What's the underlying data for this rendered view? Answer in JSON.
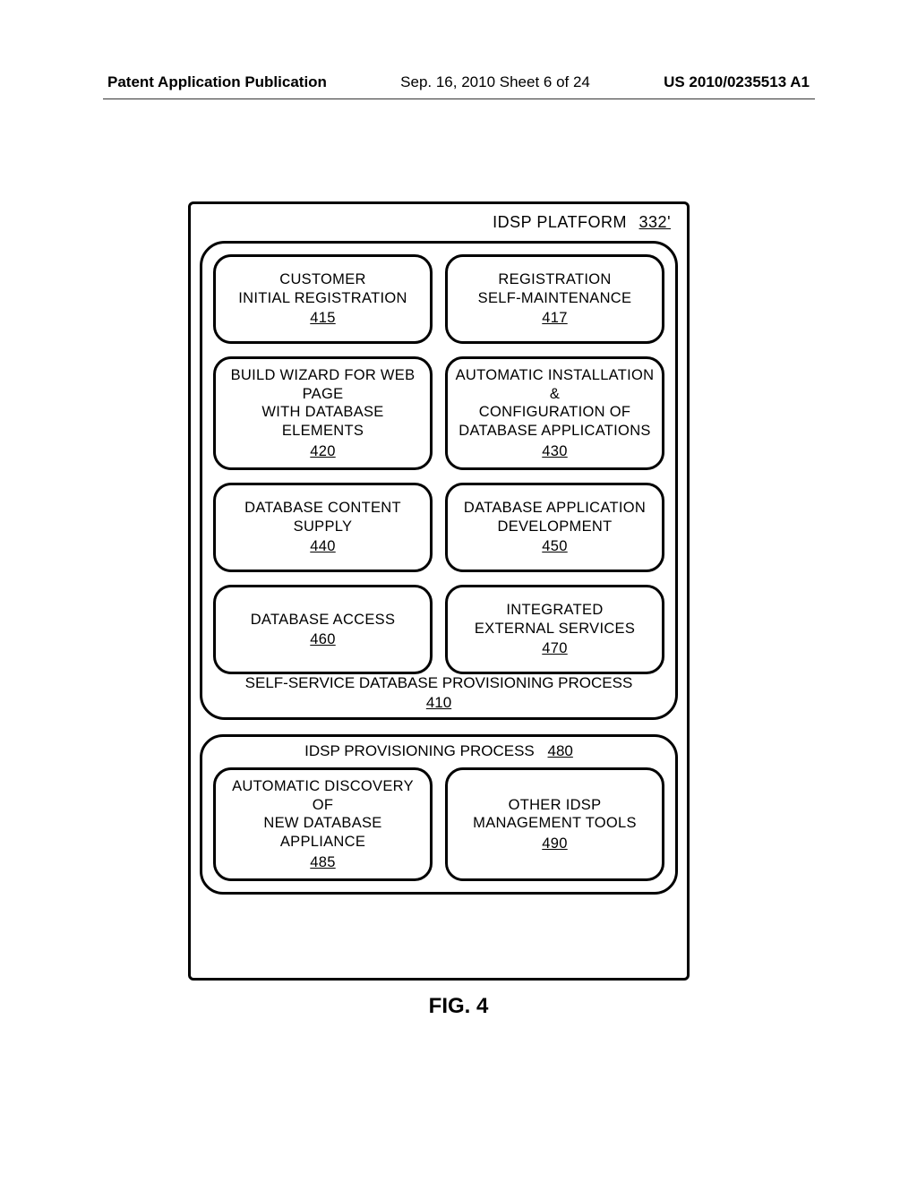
{
  "header": {
    "publication": "Patent Application Publication",
    "date": "Sep. 16, 2010  Sheet 6 of 24",
    "appnum": "US 2010/0235513 A1"
  },
  "platform": {
    "title": "IDSP PLATFORM",
    "ref": "332'"
  },
  "process410": {
    "title": "SELF-SERVICE DATABASE PROVISIONING PROCESS",
    "ref": "410",
    "cells": [
      {
        "text": "CUSTOMER\nINITIAL REGISTRATION",
        "ref": "415"
      },
      {
        "text": "REGISTRATION\nSELF-MAINTENANCE",
        "ref": "417"
      },
      {
        "text": "BUILD WIZARD FOR WEB PAGE\nWITH DATABASE ELEMENTS",
        "ref": "420"
      },
      {
        "text": "AUTOMATIC INSTALLATION &\nCONFIGURATION OF\nDATABASE APPLICATIONS",
        "ref": "430"
      },
      {
        "text": "DATABASE CONTENT\nSUPPLY",
        "ref": "440"
      },
      {
        "text": "DATABASE APPLICATION\nDEVELOPMENT",
        "ref": "450"
      },
      {
        "text": "DATABASE ACCESS",
        "ref": "460"
      },
      {
        "text": "INTEGRATED\nEXTERNAL SERVICES",
        "ref": "470"
      }
    ]
  },
  "process480": {
    "title": "IDSP PROVISIONING PROCESS",
    "ref": "480",
    "cells": [
      {
        "text": "AUTOMATIC DISCOVERY OF\nNEW DATABASE APPLIANCE",
        "ref": "485"
      },
      {
        "text": "OTHER IDSP\nMANAGEMENT TOOLS",
        "ref": "490"
      }
    ]
  },
  "figure": "FIG. 4"
}
